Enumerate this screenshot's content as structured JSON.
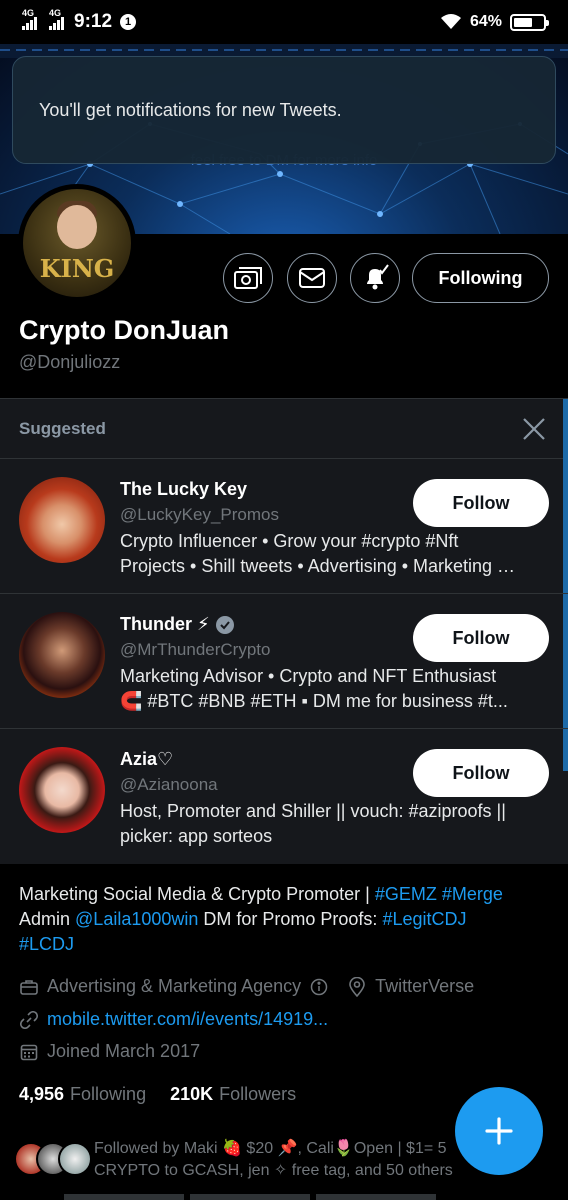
{
  "status_bar": {
    "network_1": "4G",
    "network_2": "4G",
    "time": "9:12",
    "notification_count": "1",
    "battery": "64%"
  },
  "banner": {
    "text": "feel free to DM for more info"
  },
  "toast": {
    "message": "You'll get notifications for new Tweets."
  },
  "profile": {
    "avatar_text": "KING",
    "display_name": "Crypto DonJuan",
    "handle": "@Donjuliozz",
    "following_button": "Following",
    "bio_text_1": "Marketing Social Media & Crypto Promoter | ",
    "bio_tag_gemz": "#GEMZ",
    "bio_tag_merge": "#Merge",
    "bio_text_2": "Admin ",
    "bio_mention": "@Laila1000win",
    "bio_text_3": " DM for Promo Proofs: ",
    "bio_tag_legit": "#LegitCDJ",
    "bio_tag_lcdj": "#LCDJ",
    "category": "Advertising & Marketing Agency",
    "location": "TwitterVerse",
    "website": "mobile.twitter.com/i/events/14919...",
    "joined": "Joined March 2017",
    "following_count": "4,956",
    "following_label": "Following",
    "followers_count": "210K",
    "followers_label": "Followers",
    "followed_by": "Followed by Maki 🍓 $20 📌, Cali🌷Open | $1= 5",
    "followed_by_2": "CRYPTO to GCASH, jen ✧ free tag, and 50 others"
  },
  "suggested": {
    "title": "Suggested",
    "follow_label": "Follow",
    "items": [
      {
        "name": "The Lucky Key",
        "handle": "@LuckyKey_Promos",
        "bio_1": "Crypto Influencer • Grow your #crypto #Nft",
        "bio_2": "Projects • Shill tweets • Advertising • Marketing …"
      },
      {
        "name": "Thunder ⚡",
        "handle": "@MrThunderCrypto",
        "bio_1": "Marketing Advisor • Crypto and NFT Enthusiast",
        "bio_2": "🧲 #BTC #BNB #ETH ▪ DM me for business #t..."
      },
      {
        "name": "Azia♡",
        "handle": "@Azianoona",
        "bio_1": "Host, Promoter and Shiller || vouch: #aziproofs ||",
        "bio_2": "picker: app sorteos"
      }
    ]
  },
  "colors": {
    "accent": "#1d9bf0",
    "background": "#000000",
    "secondary_text": "#71767b"
  },
  "icons": [
    "signal-icon",
    "wifi-icon",
    "battery-icon",
    "tip-jar-icon",
    "mail-icon",
    "bell-icon",
    "close-icon",
    "briefcase-icon",
    "info-icon",
    "location-icon",
    "link-icon",
    "calendar-icon",
    "verified-icon",
    "compose-plus-icon"
  ]
}
